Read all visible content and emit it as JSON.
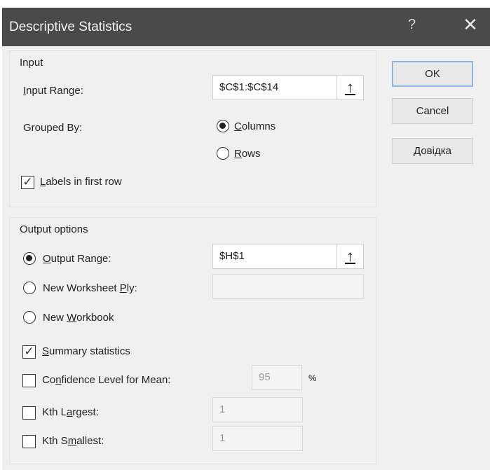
{
  "window": {
    "title": "Descriptive Statistics",
    "help_glyph": "?",
    "close_glyph": "✕"
  },
  "input": {
    "group_label": "Input",
    "range_label": "Input Range:",
    "range_value": "$C$1:$C$14",
    "grouped_by_label": "Grouped By:",
    "columns_label": "Columns",
    "rows_label": "Rows",
    "labels_first_row": "Labels in first row"
  },
  "output": {
    "group_label": "Output options",
    "output_range_label": "Output Range:",
    "output_range_value": "$H$1",
    "new_ply_label": "New Worksheet Ply:",
    "new_workbook_label": "New Workbook",
    "summary_label": "Summary statistics",
    "confidence_label": "Confidence Level for Mean:",
    "confidence_value": "95",
    "percent_sign": "%",
    "kth_largest_label": "Kth Largest:",
    "kth_largest_value": "1",
    "kth_smallest_label": "Kth Smallest:",
    "kth_smallest_value": "1"
  },
  "buttons": {
    "ok": "OK",
    "cancel": "Cancel",
    "help": "Довідка"
  },
  "state": {
    "grouped_by": "columns",
    "labels_first_row": true,
    "output_choice": "output-range",
    "summary_statistics": true,
    "confidence_level": false,
    "kth_largest": false,
    "kth_smallest": false
  },
  "icons": {
    "range_picker": "up-arrow-icon"
  }
}
